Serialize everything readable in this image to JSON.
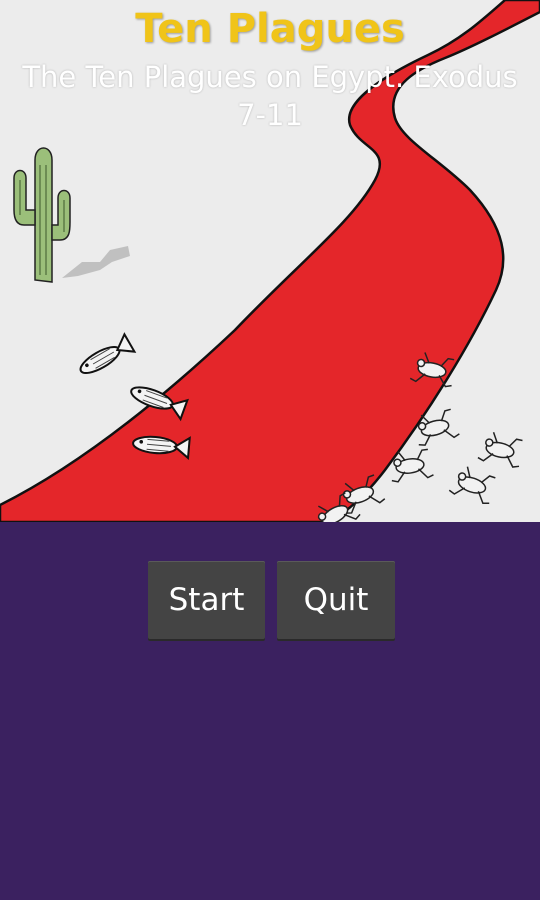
{
  "header": {
    "title": "Ten Plagues",
    "subtitle": "The Ten Plagues on Egypt. Exodus 7-11"
  },
  "menu": {
    "start_label": "Start",
    "quit_label": "Quit"
  },
  "colors": {
    "title": "#f0c419",
    "river": "#e4262a",
    "sand": "#ececec",
    "cactus": "#9bbf7a",
    "background": "#3b2160",
    "button": "#444444"
  },
  "scene": {
    "icons": [
      "cactus-icon",
      "fish-icon",
      "frog-icon"
    ]
  }
}
